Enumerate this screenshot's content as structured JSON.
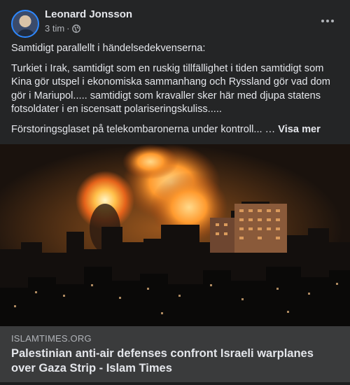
{
  "post": {
    "author": "Leonard Jonsson",
    "time": "3 tim",
    "separator": "·",
    "audience_icon": "globe-icon",
    "more_icon": "more-dots-icon",
    "paragraphs": [
      "Samtidigt parallellt i händelsedekvenserna:",
      "Turkiet i Irak, samtidigt som en ruskig tillfällighet i tiden samtidigt som Kina gör utspel i ekonomiska sammanhang och Ryssland gör vad dom gör i Mariupol..... samtidigt som kravaller sker här med djupa statens fotsoldater i en iscensatt polariseringskuliss.....",
      "Förstoringsglaset på telekombaronerna under kontroll... …"
    ],
    "see_more": "Visa mer"
  },
  "link": {
    "domain": "ISLAMTIMES.ORG",
    "title": "Palestinian anti-air defenses confront Israeli warplanes over Gaza Strip - Islam Times"
  },
  "colors": {
    "card_bg": "#242526",
    "footer_bg": "#3a3b3c",
    "primary_text": "#e4e6eb",
    "secondary_text": "#b0b3b8",
    "avatar_ring": "#2d88ff",
    "fire": "#ff9a2e"
  }
}
